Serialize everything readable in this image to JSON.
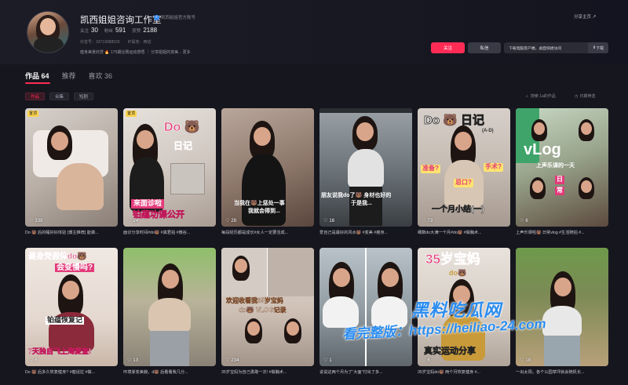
{
  "profile": {
    "name": "凯西姐姐咨询工作室",
    "verified": "凯西姐姐官方账号",
    "stats": [
      {
        "label": "关注",
        "value": "30"
      },
      {
        "label": "粉丝",
        "value": "591"
      },
      {
        "label": "获赞",
        "value": "2188"
      }
    ],
    "account_id": "抖音号：33719088529",
    "ip_location": "IP属地：西班",
    "bio": "健身美景欣赏 🔥 175期比赛运动感悟 ｜ 分享姐姐的变美... 更多",
    "share_label": "分享主页",
    "follow_label": "关注",
    "message_label": "私信",
    "download_label": "下载电脑客户端，桌面快捷访问",
    "download_button": "下载"
  },
  "tabs": [
    {
      "label": "作品 64",
      "active": true
    },
    {
      "label": "推荐",
      "active": false
    },
    {
      "label": "喜欢 36",
      "active": false
    }
  ],
  "filters": [
    {
      "label": "作品",
      "active": true
    },
    {
      "label": "合集",
      "active": false
    },
    {
      "label": "短剧",
      "active": false
    }
  ],
  "search_label": "搜索 1a的作品",
  "sort_label": "日期筛选",
  "videos": [
    {
      "badge": "置顶",
      "likes": "338",
      "caption": "Do 🐻 后的睡好好体验 [博主推荐] 能做...",
      "overlay": []
    },
    {
      "badge": "置顶",
      "likes": "24",
      "caption": "面诊分享时间#do🐻 #真君拍 #微谷...",
      "overlay": [
        "Do 🐻",
        "日记",
        "来面诊啦",
        "铂蕴功课公开"
      ]
    },
    {
      "badge": "",
      "likes": "28",
      "caption": "每段经历都是成长#女人一定要活成...",
      "overlay": [
        "当我在🐻上惩处一事",
        "我就会得到..."
      ]
    },
    {
      "badge": "",
      "likes": "16",
      "caption": "爱自己是最好的风水🐻 #变美 #瘦身...",
      "overlay": [
        "朋友说我do了🐻 身材也好的",
        "于是我..."
      ]
    },
    {
      "badge": "",
      "likes": "73",
      "caption": "细数do大满一个月#do🐻 #做胸术...",
      "overlay": [
        "Do 🐻 日记",
        "(A-D)",
        "准备?",
        "忌口?",
        "手术?",
        "一个月小结(一)"
      ]
    },
    {
      "badge": "",
      "likes": "6",
      "caption": "上声乐课啦🐻 日常vlog #生活随拍 #...",
      "overlay": [
        "vLog",
        "上声乐课的一天",
        "日",
        "常"
      ]
    },
    {
      "badge": "",
      "likes": "6",
      "caption": "Do 🐻 后多久恢复健身? #健话拉 #做...",
      "overlay": [
        "健身党假体do🐻",
        "会变慢吗?",
        "铂蕴恢复记",
        "7天独自飞上海复查!"
      ]
    },
    {
      "badge": "",
      "likes": "13",
      "caption": "环境渐变美貌，d🐻 后看看我几分...",
      "overlay": []
    },
    {
      "badge": "",
      "likes": "234",
      "caption": "35岁宝妈为自己勇敢一次! #做胸术...",
      "overlay": [
        "欢迎收看我35岁宝妈",
        "do🐻 VLOG记录"
      ]
    },
    {
      "badge": "",
      "likes": "1",
      "caption": "说说这两个月为了“大面”付出了多...",
      "overlay": []
    },
    {
      "badge": "",
      "likes": "6",
      "caption": "35岁宝妈do🐻 两个月恢复健身 #...",
      "overlay": [
        "35岁宝妈",
        "do🐻",
        "真实运动分享"
      ]
    },
    {
      "badge": "",
      "likes": "18",
      "caption": "一出太阳，各个公园草坪就会随机长...",
      "overlay": []
    }
  ],
  "watermark": {
    "line1": "黑料吃瓜网",
    "line2": "看完整版：https://heiliao-24.com"
  }
}
